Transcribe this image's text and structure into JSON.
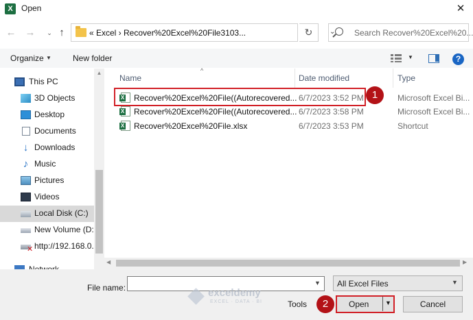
{
  "window": {
    "title": "Open",
    "app_icon": "excel-icon",
    "close_glyph": "✕"
  },
  "nav": {
    "back_glyph": "←",
    "forward_glyph": "→",
    "recent_glyph": "⌄",
    "up_glyph": "↑",
    "address_text": "«  Excel  ›  Recover%20Excel%20File3103...",
    "address_dropdown": "⌄",
    "refresh_glyph": "↻",
    "search_placeholder": "Search Recover%20Excel%20..."
  },
  "toolbar": {
    "organize_label": "Organize",
    "new_folder_label": "New folder"
  },
  "sidebar": {
    "items": [
      {
        "label": "This PC",
        "icon": "pc-icon"
      },
      {
        "label": "3D Objects",
        "icon": "cube-icon"
      },
      {
        "label": "Desktop",
        "icon": "desktop-icon"
      },
      {
        "label": "Documents",
        "icon": "documents-icon"
      },
      {
        "label": "Downloads",
        "icon": "downloads-icon"
      },
      {
        "label": "Music",
        "icon": "music-icon"
      },
      {
        "label": "Pictures",
        "icon": "pictures-icon"
      },
      {
        "label": "Videos",
        "icon": "videos-icon"
      },
      {
        "label": "Local Disk (C:)",
        "icon": "drive-icon",
        "selected": true
      },
      {
        "label": "New Volume (D:",
        "icon": "drive-icon"
      },
      {
        "label": "http://192.168.0.",
        "icon": "network-drive-icon"
      },
      {
        "label": "Network",
        "icon": "network-icon"
      }
    ]
  },
  "file_list": {
    "columns": [
      "Name",
      "Date modified",
      "Type"
    ],
    "sort_glyph": "^",
    "rows": [
      {
        "name": "Recover%20Excel%20File((Autorecovered...",
        "date": "6/7/2023 3:52 PM",
        "type": "Microsoft Excel Bi..."
      },
      {
        "name": "Recover%20Excel%20File((Autorecovered...",
        "date": "6/7/2023 3:58 PM",
        "type": "Microsoft Excel Bi..."
      },
      {
        "name": "Recover%20Excel%20File.xlsx",
        "date": "6/7/2023 3:53 PM",
        "type": "Shortcut"
      }
    ]
  },
  "badges": {
    "step1": "1",
    "step2": "2"
  },
  "footer": {
    "file_name_label": "File name:",
    "file_name_value": "",
    "filter_value": "All Excel Files",
    "tools_label": "Tools",
    "open_label": "Open",
    "cancel_label": "Cancel"
  },
  "watermark": {
    "name": "exceldemy",
    "tagline": "EXCEL · DATA · BI"
  },
  "colors": {
    "highlight": "#d11f26",
    "badge": "#b31217",
    "excel_green": "#1d6f42"
  }
}
